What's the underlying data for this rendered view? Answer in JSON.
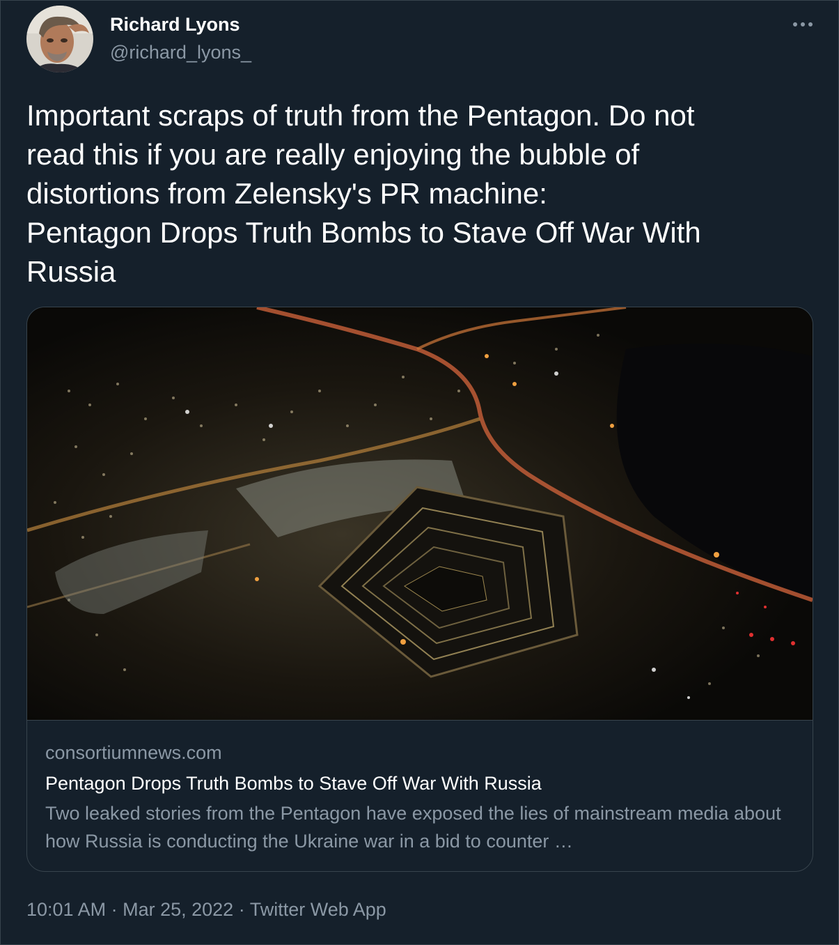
{
  "author": {
    "display_name": "Richard Lyons",
    "handle": "@richard_lyons_",
    "avatar_icon": "user-avatar-photo"
  },
  "more_icon": "more-options-icon",
  "tweet": {
    "lines": [
      "Important scraps of truth from the Pentagon. Do not",
      "read this if you are really enjoying the bubble of",
      "distortions from Zelensky's PR machine:",
      "Pentagon Drops Truth Bombs to Stave Off War With",
      "Russia"
    ]
  },
  "card": {
    "image_icon": "pentagon-night-aerial-photo",
    "domain": "consortiumnews.com",
    "title": "Pentagon Drops Truth Bombs to Stave Off War With Russia",
    "description": "Two leaked stories from the Pentagon have exposed the lies of mainstream media about how Russia is conducting the Ukraine war in a bid to counter …"
  },
  "meta": {
    "time": "10:01 AM",
    "sep1": " · ",
    "date": "Mar 25, 2022",
    "sep2": " · ",
    "source": "Twitter Web App"
  },
  "colors": {
    "background": "#15202b",
    "border": "#38444d",
    "text_primary": "#ffffff",
    "text_secondary": "#8b98a5"
  }
}
